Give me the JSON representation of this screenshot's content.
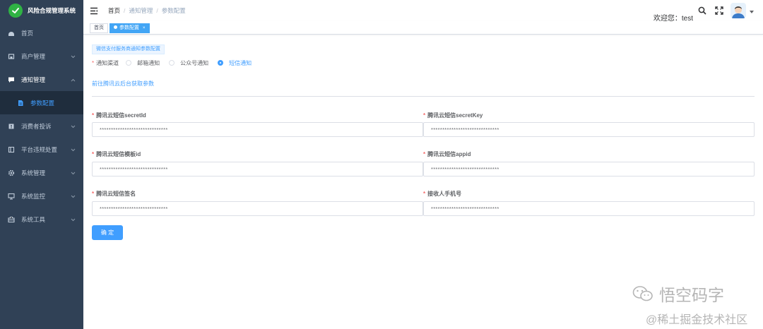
{
  "app": {
    "title": "风险合规管理系统"
  },
  "sidebar": {
    "items": [
      {
        "label": "首页",
        "icon": "dashboard-icon"
      },
      {
        "label": "商户管理",
        "icon": "shop-icon"
      },
      {
        "label": "通知管理",
        "icon": "message-icon"
      },
      {
        "label": "参数配置",
        "icon": "document-icon"
      },
      {
        "label": "消费者投诉",
        "icon": "complaint-icon"
      },
      {
        "label": "平台违规处置",
        "icon": "platform-icon"
      },
      {
        "label": "系统管理",
        "icon": "gear-icon"
      },
      {
        "label": "系统监控",
        "icon": "monitor-icon"
      },
      {
        "label": "系统工具",
        "icon": "toolbox-icon"
      }
    ]
  },
  "header": {
    "breadcrumb": [
      "首页",
      "通知管理",
      "参数配置"
    ],
    "welcome": "欢迎您：test"
  },
  "tags": [
    {
      "label": "首页"
    },
    {
      "label": "参数配置",
      "close": "×"
    }
  ],
  "form": {
    "tip": "微信支付服务商通知参数配置",
    "channel_label": "通知渠道",
    "channels": [
      "邮箱通知",
      "公众号通知",
      "短信通知"
    ],
    "selected_channel": "短信通知",
    "link": "前往腾讯云后台获取参数",
    "fields": [
      {
        "label": "腾讯云短信secretId",
        "value": "******************************"
      },
      {
        "label": "腾讯云短信secretKey",
        "value": "******************************"
      },
      {
        "label": "腾讯云短信模板id",
        "value": "******************************"
      },
      {
        "label": "腾讯云短信appid",
        "value": "******************************"
      },
      {
        "label": "腾讯云短信签名",
        "value": "******************************"
      },
      {
        "label": "接收人手机号",
        "value": "******************************"
      }
    ],
    "submit": "确 定"
  },
  "watermark": {
    "line1": "悟空码字",
    "line2": "@稀土掘金技术社区"
  },
  "colors": {
    "sidebar": "#304156",
    "primary": "#409eff",
    "required": "#f56c6c"
  }
}
